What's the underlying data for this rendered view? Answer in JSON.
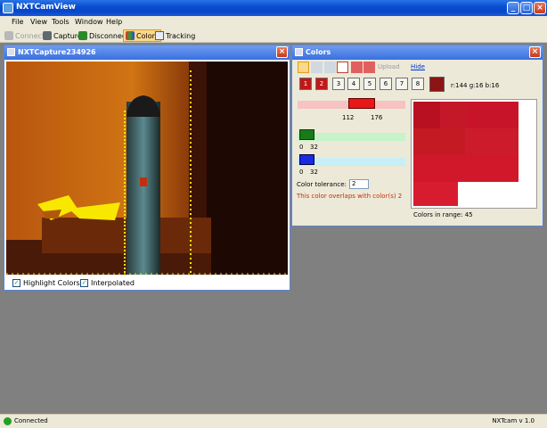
{
  "app": {
    "title": "NXTCamView",
    "version": "NXTcam v 1.0"
  },
  "menu": [
    "File",
    "View",
    "Tools",
    "Window",
    "Help"
  ],
  "toolbar": {
    "connect": "Connect",
    "capture": "Capture",
    "disconnect": "Disconnect",
    "colors": "Colors",
    "tracking": "Tracking"
  },
  "capture_window": {
    "title": "NXTCapture234926",
    "highlight_label": "Highlight Colors",
    "interpolated_label": "Interpolated"
  },
  "colors_window": {
    "title": "Colors",
    "upload": "Upload",
    "hide": "Hide",
    "color_slots": [
      "1",
      "2",
      "3",
      "4",
      "5",
      "6",
      "7",
      "8"
    ],
    "rgb_readout": "r:144 g:16 b:16",
    "selected_color": "#8c1414",
    "red_low": "112",
    "red_high": "176",
    "green_low": "0",
    "green_high": "32",
    "blue_low": "0",
    "blue_high": "32",
    "tolerance_label": "Color tolerance:",
    "tolerance_value": "2",
    "overlap_warning": "This color overlaps with color(s) 2",
    "colors_in_range": "Colors in range: 45"
  },
  "status": {
    "text": "Connected",
    "color": "#21a121"
  }
}
